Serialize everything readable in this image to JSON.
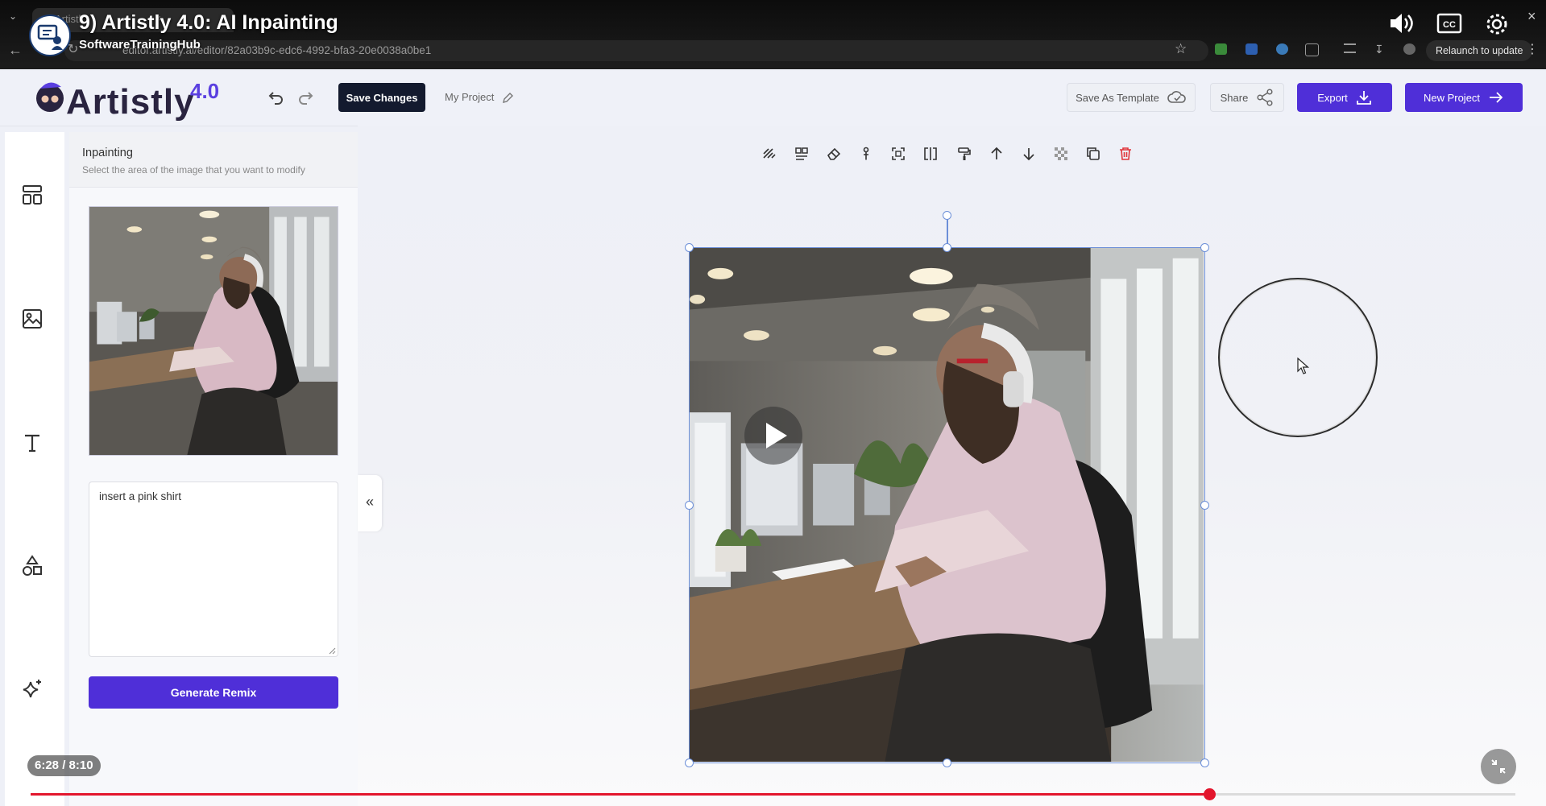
{
  "video": {
    "title": "9) Artistly 4.0: AI Inpainting",
    "channel": "SoftwareTrainingHub",
    "time": "6:28 / 8:10",
    "progress_fraction": 0.794
  },
  "browser": {
    "tab_title": "Artistl",
    "url": "editor.artistly.ai/editor/82a03b9c-edc6-4992-bfa3-20e0038a0be1",
    "relaunch_label": "Relaunch to update"
  },
  "header": {
    "logo_word": "Artistly",
    "logo_version": "4.0",
    "save_label": "Save Changes",
    "project_name": "My Project",
    "save_template_label": "Save As Template",
    "share_label": "Share",
    "export_label": "Export",
    "new_project_label": "New Project"
  },
  "panel": {
    "title": "Inpainting",
    "subtitle": "Select the area of the image that you want to modify",
    "prompt_value": "insert a pink shirt",
    "generate_label": "Generate Remix",
    "collapse_glyph": "«"
  },
  "rail": {
    "icons": [
      "layout-icon",
      "image-icon",
      "text-icon",
      "shapes-icon",
      "sparkle-icon"
    ]
  },
  "toolbar": {
    "icons": [
      "pattern-icon",
      "align-icon",
      "eraser-icon",
      "pin-icon",
      "crop-icon",
      "flip-icon",
      "paint-roller-icon",
      "arrow-up-icon",
      "arrow-down-icon",
      "transparency-icon",
      "duplicate-icon",
      "trash-icon"
    ]
  },
  "colors": {
    "accent": "#4f2fd8",
    "dark_button": "#131a2e",
    "progress_red": "#e3162d",
    "selection_blue": "#6c8fd8",
    "trash_red": "#e0353b"
  }
}
